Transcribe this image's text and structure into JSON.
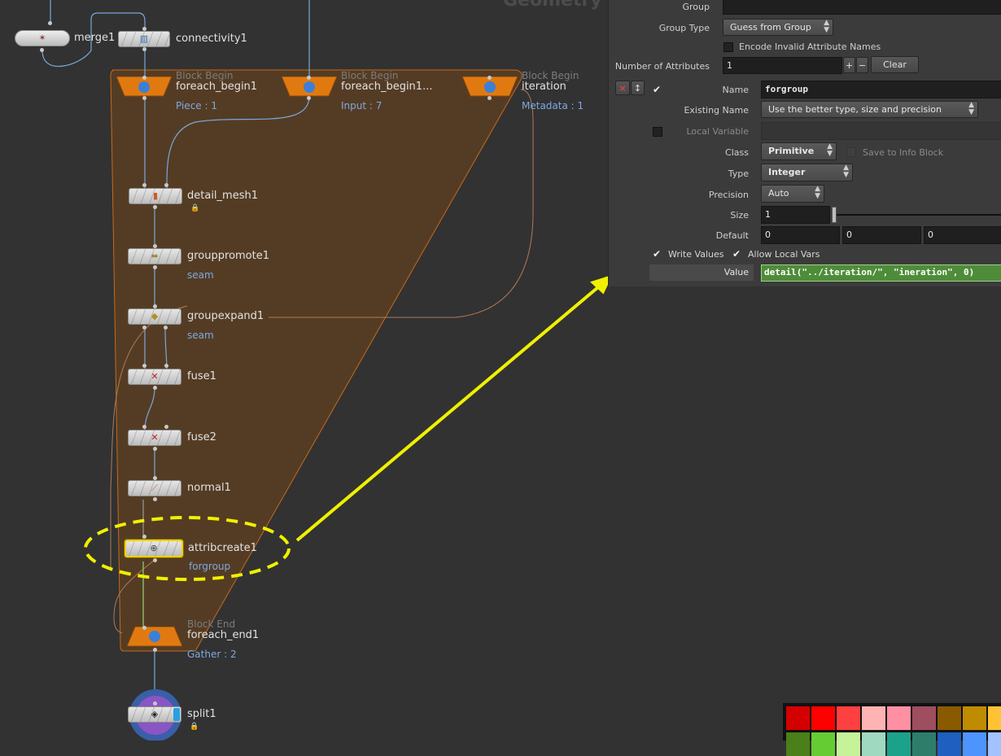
{
  "network": {
    "header_title": "Geometry",
    "nodes": {
      "merge": {
        "label": "merge1"
      },
      "connectivity": {
        "label": "connectivity1"
      },
      "foreach_begin1": {
        "header": "Block Begin",
        "label": "foreach_begin1",
        "sub": "Piece : 1"
      },
      "foreach_begin1b": {
        "header": "Block Begin",
        "label": "foreach_begin1...",
        "sub": "Input : 7"
      },
      "iteration": {
        "header": "Block Begin",
        "label": "iteration",
        "sub": "Metadata : 1"
      },
      "detail_mesh": {
        "label": "detail_mesh1"
      },
      "grouppromote": {
        "label": "grouppromote1",
        "sub": "seam"
      },
      "groupexpand": {
        "label": "groupexpand1",
        "sub": "seam"
      },
      "fuse1": {
        "label": "fuse1"
      },
      "fuse2": {
        "label": "fuse2"
      },
      "normal": {
        "label": "normal1"
      },
      "attribcreate": {
        "label": "attribcreate1",
        "sub": "forgroup"
      },
      "foreach_end": {
        "header": "Block End",
        "label": "foreach_end1",
        "sub": "Gather : 2"
      },
      "split": {
        "label": "split1"
      }
    }
  },
  "params": {
    "group_label": "Group",
    "group_value": "",
    "group_type_label": "Group Type",
    "group_type_value": "Guess from Group",
    "encode_label": "Encode Invalid Attribute Names",
    "num_attr_label": "Number of Attributes",
    "num_attr_value": "1",
    "plus": "+",
    "minus": "−",
    "clear": "Clear",
    "remove_btn": "×",
    "move_btn": "↕",
    "name_label": "Name",
    "name_value": "forgroup",
    "existing_name_label": "Existing Name",
    "existing_name_value": "Use the better type, size and precision",
    "local_variable_label": "Local Variable",
    "class_label": "Class",
    "class_value": "Primitive",
    "save_info_label": "Save to Info Block",
    "type_label": "Type",
    "type_value": "Integer",
    "precision_label": "Precision",
    "precision_value": "Auto",
    "size_label": "Size",
    "size_value": "1",
    "default_label": "Default",
    "default_values": [
      "0",
      "0",
      "0"
    ],
    "write_values_label": "Write Values",
    "allow_local_vars_label": "Allow Local Vars",
    "value_label": "Value",
    "value_expression": "detail(\"../iteration/\", \"ineration\", 0)"
  },
  "colors": {
    "highlight_annotation": "#f0f000",
    "block_fill": "#5a3e22",
    "block_border": "#c8691a",
    "value_field": "#4f8c3a"
  },
  "palette": [
    "#d40000",
    "#ff0000",
    "#ff4040",
    "#ffb3b3",
    "#ff8fa3",
    "#9e4e5e",
    "#8a5a00",
    "#bf8c00",
    "#ffc233",
    "#4a7f1a",
    "#66cc33",
    "#c6f29a",
    "#9ed9c0",
    "#1aa38a",
    "#2e7d6b",
    "#1f5fbf",
    "#4d94ff",
    "#a3c2ff"
  ]
}
